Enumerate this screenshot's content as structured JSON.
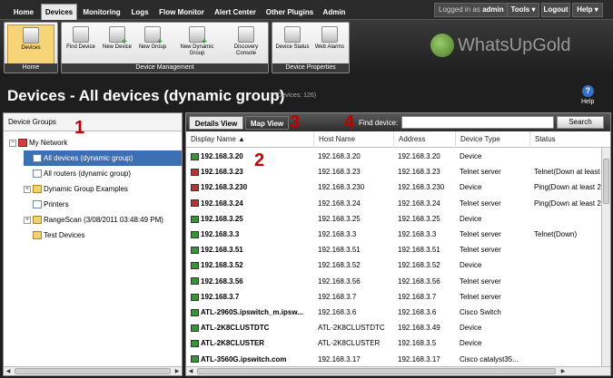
{
  "nav": {
    "tabs": [
      "Home",
      "Devices",
      "Monitoring",
      "Logs",
      "Flow Monitor",
      "Alert Center",
      "Other Plugins",
      "Admin"
    ],
    "logged_in_prefix": "Logged in as",
    "user": "admin",
    "tools": "Tools",
    "logout": "Logout",
    "help": "Help"
  },
  "ribbon": {
    "home_group": {
      "label": "Home",
      "devices_button": "Devices"
    },
    "device_management": {
      "label": "Device Management",
      "buttons": [
        "Find Device",
        "New Device",
        "New Group",
        "New Dynamic Group",
        "Discovery Console"
      ]
    },
    "device_properties": {
      "label": "Device Properties",
      "buttons": [
        "Device Status",
        "Web Alarms"
      ]
    },
    "logo_text": "WhatsUpGold"
  },
  "page": {
    "title": "Devices - All devices (dynamic group)",
    "device_count": "(Devices: 126)",
    "help_label": "Help"
  },
  "device_groups": {
    "header": "Device Groups",
    "items": [
      {
        "label": "My Network",
        "expander": "−"
      },
      {
        "label": "All devices (dynamic group)"
      },
      {
        "label": "All routers (dynamic group)"
      },
      {
        "label": "Dynamic Group Examples",
        "expander": "+"
      },
      {
        "label": "Printers"
      },
      {
        "label": "RangeScan (3/08/2011 03:48:49 PM)",
        "expander": "+"
      },
      {
        "label": "Test Devices"
      }
    ]
  },
  "toolbar": {
    "details_view": "Details View",
    "map_view": "Map View",
    "find_label": "Find device:",
    "find_value": "",
    "search_button": "Search"
  },
  "table": {
    "columns": [
      "Display Name ▲",
      "Host Name",
      "Address",
      "Device Type",
      "Status"
    ],
    "rows": [
      {
        "name": "192.168.3.20",
        "host": "192.168.3.20",
        "address": "192.168.3.20",
        "type": "Device",
        "status": "",
        "color": "#2f9a2f"
      },
      {
        "name": "192.168.3.23",
        "host": "192.168.3.23",
        "address": "192.168.3.23",
        "type": "Telnet server",
        "status": "Telnet(Down at least",
        "color": "#c03030"
      },
      {
        "name": "192.168.3.230",
        "host": "192.168.3.230",
        "address": "192.168.3.230",
        "type": "Device",
        "status": "Ping(Down at least 2",
        "color": "#c03030"
      },
      {
        "name": "192.168.3.24",
        "host": "192.168.3.24",
        "address": "192.168.3.24",
        "type": "Telnet server",
        "status": "Ping(Down at least 2",
        "color": "#c03030"
      },
      {
        "name": "192.168.3.25",
        "host": "192.168.3.25",
        "address": "192.168.3.25",
        "type": "Device",
        "status": "",
        "color": "#2f9a2f"
      },
      {
        "name": "192.168.3.3",
        "host": "192.168.3.3",
        "address": "192.168.3.3",
        "type": "Telnet server",
        "status": "Telnet(Down)",
        "color": "#2f9a2f"
      },
      {
        "name": "192.168.3.51",
        "host": "192.168.3.51",
        "address": "192.168.3.51",
        "type": "Telnet server",
        "status": "",
        "color": "#2f9a2f"
      },
      {
        "name": "192.168.3.52",
        "host": "192.168.3.52",
        "address": "192.168.3.52",
        "type": "Device",
        "status": "",
        "color": "#2f9a2f"
      },
      {
        "name": "192.168.3.56",
        "host": "192.168.3.56",
        "address": "192.168.3.56",
        "type": "Telnet server",
        "status": "",
        "color": "#2f9a2f"
      },
      {
        "name": "192.168.3.7",
        "host": "192.168.3.7",
        "address": "192.168.3.7",
        "type": "Telnet server",
        "status": "",
        "color": "#2f9a2f"
      },
      {
        "name": "ATL-2960S.ipswitch_m.ipsw...",
        "host": "192.168.3.6",
        "address": "192.168.3.6",
        "type": "Cisco Switch",
        "status": "",
        "color": "#2f9a2f"
      },
      {
        "name": "ATL-2K8CLUSTDTC",
        "host": "ATL-2K8CLUSTDTC",
        "address": "192.168.3.49",
        "type": "Device",
        "status": "",
        "color": "#2f9a2f"
      },
      {
        "name": "ATL-2K8CLUSTER",
        "host": "ATL-2K8CLUSTER",
        "address": "192.168.3.5",
        "type": "Device",
        "status": "",
        "color": "#2f9a2f"
      },
      {
        "name": "ATL-3560G.ipswitch.com",
        "host": "192.168.3.17",
        "address": "192.168.3.17",
        "type": "Cisco catalyst35...",
        "status": "",
        "color": "#2f9a2f"
      }
    ]
  },
  "callouts": [
    "1",
    "2",
    "3",
    "4"
  ]
}
